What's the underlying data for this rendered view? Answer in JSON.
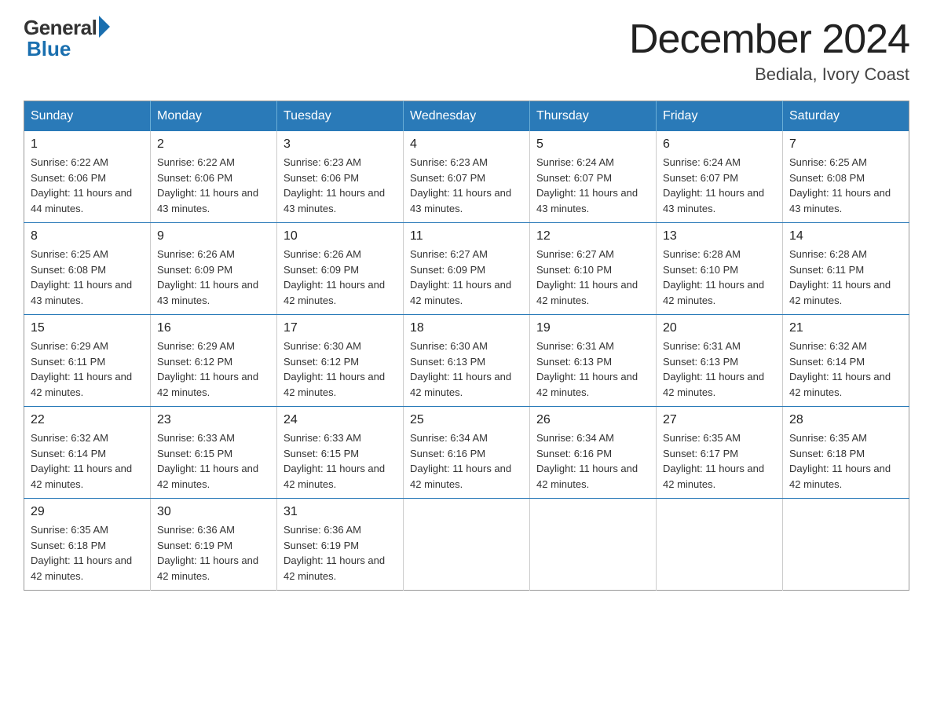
{
  "logo": {
    "general": "General",
    "blue": "Blue"
  },
  "title": "December 2024",
  "location": "Bediala, Ivory Coast",
  "headers": [
    "Sunday",
    "Monday",
    "Tuesday",
    "Wednesday",
    "Thursday",
    "Friday",
    "Saturday"
  ],
  "weeks": [
    [
      {
        "day": "1",
        "sunrise": "6:22 AM",
        "sunset": "6:06 PM",
        "daylight": "11 hours and 44 minutes."
      },
      {
        "day": "2",
        "sunrise": "6:22 AM",
        "sunset": "6:06 PM",
        "daylight": "11 hours and 43 minutes."
      },
      {
        "day": "3",
        "sunrise": "6:23 AM",
        "sunset": "6:06 PM",
        "daylight": "11 hours and 43 minutes."
      },
      {
        "day": "4",
        "sunrise": "6:23 AM",
        "sunset": "6:07 PM",
        "daylight": "11 hours and 43 minutes."
      },
      {
        "day": "5",
        "sunrise": "6:24 AM",
        "sunset": "6:07 PM",
        "daylight": "11 hours and 43 minutes."
      },
      {
        "day": "6",
        "sunrise": "6:24 AM",
        "sunset": "6:07 PM",
        "daylight": "11 hours and 43 minutes."
      },
      {
        "day": "7",
        "sunrise": "6:25 AM",
        "sunset": "6:08 PM",
        "daylight": "11 hours and 43 minutes."
      }
    ],
    [
      {
        "day": "8",
        "sunrise": "6:25 AM",
        "sunset": "6:08 PM",
        "daylight": "11 hours and 43 minutes."
      },
      {
        "day": "9",
        "sunrise": "6:26 AM",
        "sunset": "6:09 PM",
        "daylight": "11 hours and 43 minutes."
      },
      {
        "day": "10",
        "sunrise": "6:26 AM",
        "sunset": "6:09 PM",
        "daylight": "11 hours and 42 minutes."
      },
      {
        "day": "11",
        "sunrise": "6:27 AM",
        "sunset": "6:09 PM",
        "daylight": "11 hours and 42 minutes."
      },
      {
        "day": "12",
        "sunrise": "6:27 AM",
        "sunset": "6:10 PM",
        "daylight": "11 hours and 42 minutes."
      },
      {
        "day": "13",
        "sunrise": "6:28 AM",
        "sunset": "6:10 PM",
        "daylight": "11 hours and 42 minutes."
      },
      {
        "day": "14",
        "sunrise": "6:28 AM",
        "sunset": "6:11 PM",
        "daylight": "11 hours and 42 minutes."
      }
    ],
    [
      {
        "day": "15",
        "sunrise": "6:29 AM",
        "sunset": "6:11 PM",
        "daylight": "11 hours and 42 minutes."
      },
      {
        "day": "16",
        "sunrise": "6:29 AM",
        "sunset": "6:12 PM",
        "daylight": "11 hours and 42 minutes."
      },
      {
        "day": "17",
        "sunrise": "6:30 AM",
        "sunset": "6:12 PM",
        "daylight": "11 hours and 42 minutes."
      },
      {
        "day": "18",
        "sunrise": "6:30 AM",
        "sunset": "6:13 PM",
        "daylight": "11 hours and 42 minutes."
      },
      {
        "day": "19",
        "sunrise": "6:31 AM",
        "sunset": "6:13 PM",
        "daylight": "11 hours and 42 minutes."
      },
      {
        "day": "20",
        "sunrise": "6:31 AM",
        "sunset": "6:13 PM",
        "daylight": "11 hours and 42 minutes."
      },
      {
        "day": "21",
        "sunrise": "6:32 AM",
        "sunset": "6:14 PM",
        "daylight": "11 hours and 42 minutes."
      }
    ],
    [
      {
        "day": "22",
        "sunrise": "6:32 AM",
        "sunset": "6:14 PM",
        "daylight": "11 hours and 42 minutes."
      },
      {
        "day": "23",
        "sunrise": "6:33 AM",
        "sunset": "6:15 PM",
        "daylight": "11 hours and 42 minutes."
      },
      {
        "day": "24",
        "sunrise": "6:33 AM",
        "sunset": "6:15 PM",
        "daylight": "11 hours and 42 minutes."
      },
      {
        "day": "25",
        "sunrise": "6:34 AM",
        "sunset": "6:16 PM",
        "daylight": "11 hours and 42 minutes."
      },
      {
        "day": "26",
        "sunrise": "6:34 AM",
        "sunset": "6:16 PM",
        "daylight": "11 hours and 42 minutes."
      },
      {
        "day": "27",
        "sunrise": "6:35 AM",
        "sunset": "6:17 PM",
        "daylight": "11 hours and 42 minutes."
      },
      {
        "day": "28",
        "sunrise": "6:35 AM",
        "sunset": "6:18 PM",
        "daylight": "11 hours and 42 minutes."
      }
    ],
    [
      {
        "day": "29",
        "sunrise": "6:35 AM",
        "sunset": "6:18 PM",
        "daylight": "11 hours and 42 minutes."
      },
      {
        "day": "30",
        "sunrise": "6:36 AM",
        "sunset": "6:19 PM",
        "daylight": "11 hours and 42 minutes."
      },
      {
        "day": "31",
        "sunrise": "6:36 AM",
        "sunset": "6:19 PM",
        "daylight": "11 hours and 42 minutes."
      },
      null,
      null,
      null,
      null
    ]
  ]
}
